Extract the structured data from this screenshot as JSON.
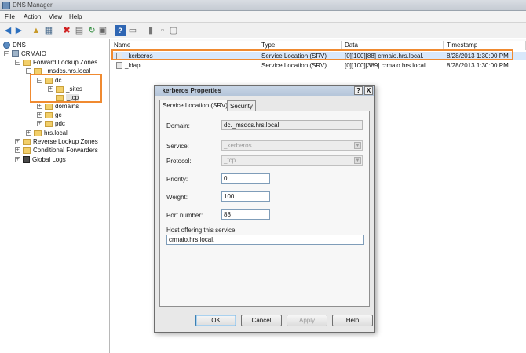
{
  "window": {
    "title": "DNS Manager"
  },
  "menu": {
    "file": "File",
    "action": "Action",
    "view": "View",
    "help": "Help"
  },
  "toolbar": {
    "back_icon": "arrow-left-icon",
    "forward_icon": "arrow-right-icon",
    "up_icon": "folder-up-icon",
    "show_tree_icon": "console-tree-icon",
    "delete_icon": "red-x-icon",
    "properties_icon": "properties-icon",
    "refresh_icon": "refresh-icon",
    "export_icon": "export-list-icon",
    "help_icon": "help-icon",
    "console_icon": "console-icon",
    "server_icon": "server-icon",
    "zone_icon": "zone-icon",
    "filter_icon": "filter-icon"
  },
  "tree": {
    "root": "DNS",
    "server": "CRMAIO",
    "forward_zones": "Forward Lookup Zones",
    "msdcs": "_msdcs.hrs.local",
    "dc": "dc",
    "sites": "_sites",
    "tcp": "_tcp",
    "domains": "domains",
    "gc": "gc",
    "pdc": "pdc",
    "hrs_local": "hrs.local",
    "reverse_zones": "Reverse Lookup Zones",
    "conditional_forwarders": "Conditional Forwarders",
    "global_logs": "Global Logs"
  },
  "list": {
    "columns": {
      "name": "Name",
      "type": "Type",
      "data": "Data",
      "timestamp": "Timestamp"
    },
    "rows": [
      {
        "name": "_kerberos",
        "type": "Service Location (SRV)",
        "data": "[0][100][88] crmaio.hrs.local.",
        "timestamp": "8/28/2013 1:30:00 PM"
      },
      {
        "name": "_ldap",
        "type": "Service Location (SRV)",
        "data": "[0][100][389] crmaio.hrs.local.",
        "timestamp": "8/28/2013 1:30:00 PM"
      }
    ]
  },
  "dialog": {
    "title": "_kerberos Properties",
    "help_btn": "?",
    "close_btn": "X",
    "tabs": {
      "srv": "Service Location (SRV)",
      "security": "Security"
    },
    "domain_label": "Domain:",
    "domain_value": "dc._msdcs.hrs.local",
    "service_label": "Service:",
    "service_value": "_kerberos",
    "protocol_label": "Protocol:",
    "protocol_value": "_tcp",
    "priority_label": "Priority:",
    "priority_value": "0",
    "weight_label": "Weight:",
    "weight_value": "100",
    "port_label": "Port number:",
    "port_value": "88",
    "host_label": "Host offering this service:",
    "host_value": "crmaio.hrs.local.",
    "buttons": {
      "ok": "OK",
      "cancel": "Cancel",
      "apply": "Apply",
      "help": "Help"
    }
  },
  "colors": {
    "highlight": "#f08a30",
    "selection": "#d9e8fb"
  }
}
